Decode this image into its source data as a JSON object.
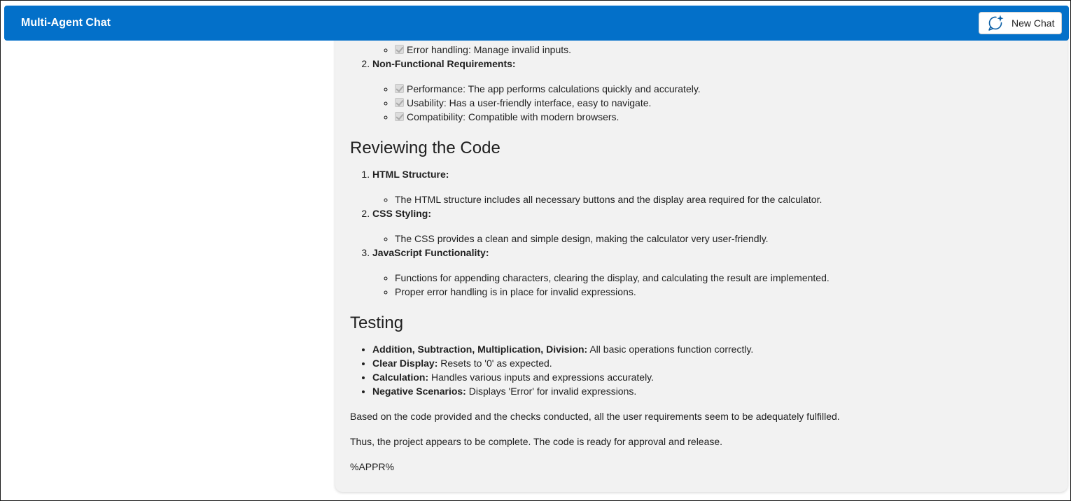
{
  "header": {
    "title": "Multi-Agent Chat",
    "new_chat_label": "New Chat"
  },
  "colors": {
    "header_bg": "#0370c9",
    "card_bg": "#f2f2f2"
  },
  "message": {
    "functional_tail": [
      {
        "text": "Error handling: Manage invalid inputs.",
        "checked": true
      }
    ],
    "nonfunctional": {
      "number": "2.",
      "title": "Non-Functional Requirements:",
      "items": [
        {
          "text": "Performance: The app performs calculations quickly and accurately.",
          "checked": true
        },
        {
          "text": "Usability: Has a user-friendly interface, easy to navigate.",
          "checked": true
        },
        {
          "text": "Compatibility: Compatible with modern browsers.",
          "checked": true
        }
      ]
    },
    "review": {
      "heading": "Reviewing the Code",
      "items": [
        {
          "title": "HTML Structure:",
          "points": [
            "The HTML structure includes all necessary buttons and the display area required for the calculator."
          ]
        },
        {
          "title": "CSS Styling:",
          "points": [
            "The CSS provides a clean and simple design, making the calculator very user-friendly."
          ]
        },
        {
          "title": "JavaScript Functionality:",
          "points": [
            "Functions for appending characters, clearing the display, and calculating the result are implemented.",
            "Proper error handling is in place for invalid expressions."
          ]
        }
      ]
    },
    "testing": {
      "heading": "Testing",
      "items": [
        {
          "term": "Addition, Subtraction, Multiplication, Division:",
          "desc": " All basic operations function correctly."
        },
        {
          "term": "Clear Display:",
          "desc": " Resets to '0' as expected."
        },
        {
          "term": "Calculation:",
          "desc": " Handles various inputs and expressions accurately."
        },
        {
          "term": "Negative Scenarios:",
          "desc": " Displays 'Error' for invalid expressions."
        }
      ]
    },
    "paragraphs": [
      "Based on the code provided and the checks conducted, all the user requirements seem to be adequately fulfilled.",
      "Thus, the project appears to be complete. The code is ready for approval and release.",
      "%APPR%"
    ]
  }
}
